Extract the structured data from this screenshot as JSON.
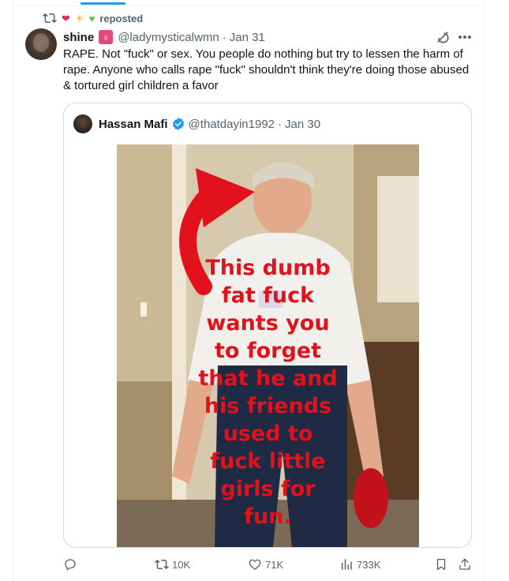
{
  "repost_header": {
    "emoji_heart": "❤",
    "emoji_sun": "☀",
    "emoji_green_heart": "♥",
    "label": "reposted"
  },
  "tweet": {
    "display_name": "shine",
    "badge_symbol": "♀",
    "handle": "@ladymysticalwmn",
    "separator": "·",
    "date": "Jan 31",
    "text": "RAPE. Not \"fuck\" or sex. You people do nothing but try to lessen the harm of rape. Anyone who calls rape \"fuck\" shouldn't think they're doing those abused & tortured girl children a favor"
  },
  "quoted_tweet": {
    "display_name": "Hassan Mafi",
    "handle": "@thatdayin1992",
    "separator": "·",
    "date": "Jan 30",
    "image_overlay_lines": [
      "This dumb",
      "fat fuck",
      "wants you",
      "to forget",
      "that he and",
      "his friends",
      "used to",
      "fuck little",
      "girls for",
      "fun."
    ]
  },
  "actions": {
    "reply_count": "",
    "repost_count": "10K",
    "like_count": "71K",
    "view_count": "733K"
  },
  "colors": {
    "accent": "#1d9bf0",
    "text_primary": "#0f1419",
    "text_muted": "#536471",
    "overlay_text": "#e1121b",
    "badge_female": "#e8457f"
  }
}
